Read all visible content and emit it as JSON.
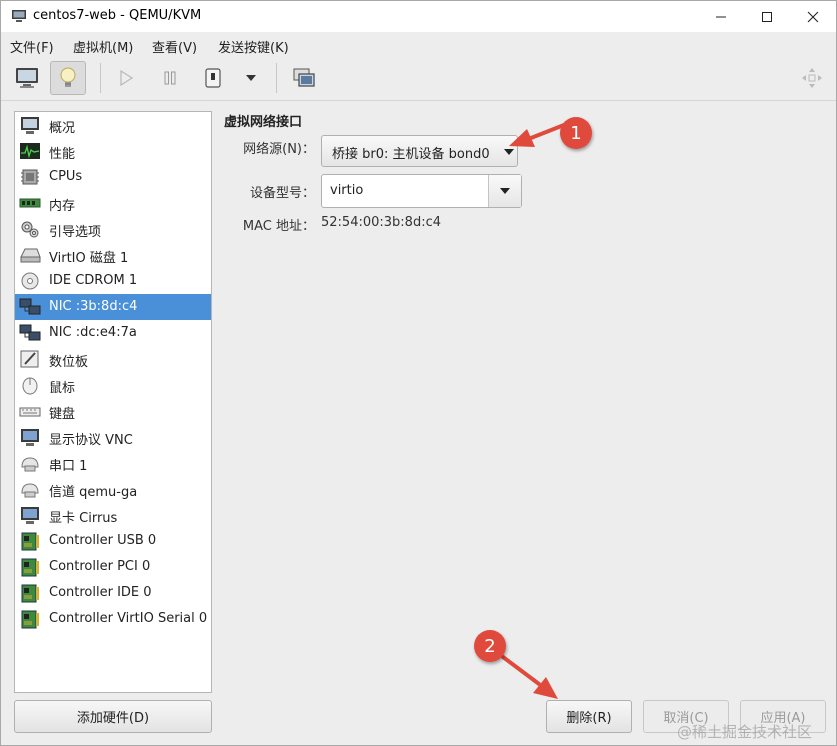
{
  "window": {
    "title": "centos7-web - QEMU/KVM"
  },
  "menubar": {
    "items": [
      "文件(F)",
      "虚拟机(M)",
      "查看(V)",
      "发送按键(K)"
    ]
  },
  "toolbar": {
    "buttons": [
      "monitor-icon",
      "lightbulb-icon",
      "play-icon",
      "pause-icon",
      "power-icon",
      "dropdown-arrow-icon",
      "screenshot-icon",
      "fullscreen-icon"
    ],
    "active": "lightbulb-icon"
  },
  "hardware": {
    "items": [
      {
        "label": "概况",
        "icon": "overview-monitor-icon"
      },
      {
        "label": "性能",
        "icon": "performance-graph-icon"
      },
      {
        "label": "CPUs",
        "icon": "cpu-chip-icon"
      },
      {
        "label": "内存",
        "icon": "memory-stick-icon"
      },
      {
        "label": "引导选项",
        "icon": "boot-gears-icon"
      },
      {
        "label": "VirtIO 磁盘 1",
        "icon": "disk-icon"
      },
      {
        "label": "IDE CDROM 1",
        "icon": "cdrom-icon"
      },
      {
        "label": "NIC :3b:8d:c4",
        "icon": "network-icon"
      },
      {
        "label": "NIC :dc:e4:7a",
        "icon": "network-icon"
      },
      {
        "label": "数位板",
        "icon": "tablet-icon"
      },
      {
        "label": "鼠标",
        "icon": "mouse-icon"
      },
      {
        "label": "键盘",
        "icon": "keyboard-icon"
      },
      {
        "label": "显示协议 VNC",
        "icon": "display-monitor-icon"
      },
      {
        "label": "串口 1",
        "icon": "serial-port-icon"
      },
      {
        "label": "信道 qemu-ga",
        "icon": "channel-icon"
      },
      {
        "label": "显卡 Cirrus",
        "icon": "video-card-icon"
      },
      {
        "label": "Controller USB 0",
        "icon": "controller-card-icon"
      },
      {
        "label": "Controller PCI 0",
        "icon": "controller-card-icon"
      },
      {
        "label": "Controller IDE 0",
        "icon": "controller-card-icon"
      },
      {
        "label": "Controller VirtIO Serial 0",
        "icon": "controller-card-icon"
      }
    ],
    "selected": "NIC :3b:8d:c4",
    "add_label": "添加硬件(D)"
  },
  "details": {
    "section_title": "虚拟网络接口",
    "source_label": "网络源(N)：",
    "source_value": "桥接  br0: 主机设备  bond0",
    "model_label": "设备型号：",
    "model_value": "virtio",
    "mac_label": "MAC 地址：",
    "mac_value": "52:54:00:3b:8d:c4"
  },
  "actions": {
    "remove": "删除(R)",
    "cancel": "取消(C)",
    "apply": "应用(A)"
  },
  "annotations": {
    "badge1": "1",
    "badge2": "2",
    "color": "#e04a3c"
  },
  "watermark": "@稀土掘金技术社区",
  "colors": {
    "selection": "#4a90d9",
    "window_bg": "#ededed"
  }
}
